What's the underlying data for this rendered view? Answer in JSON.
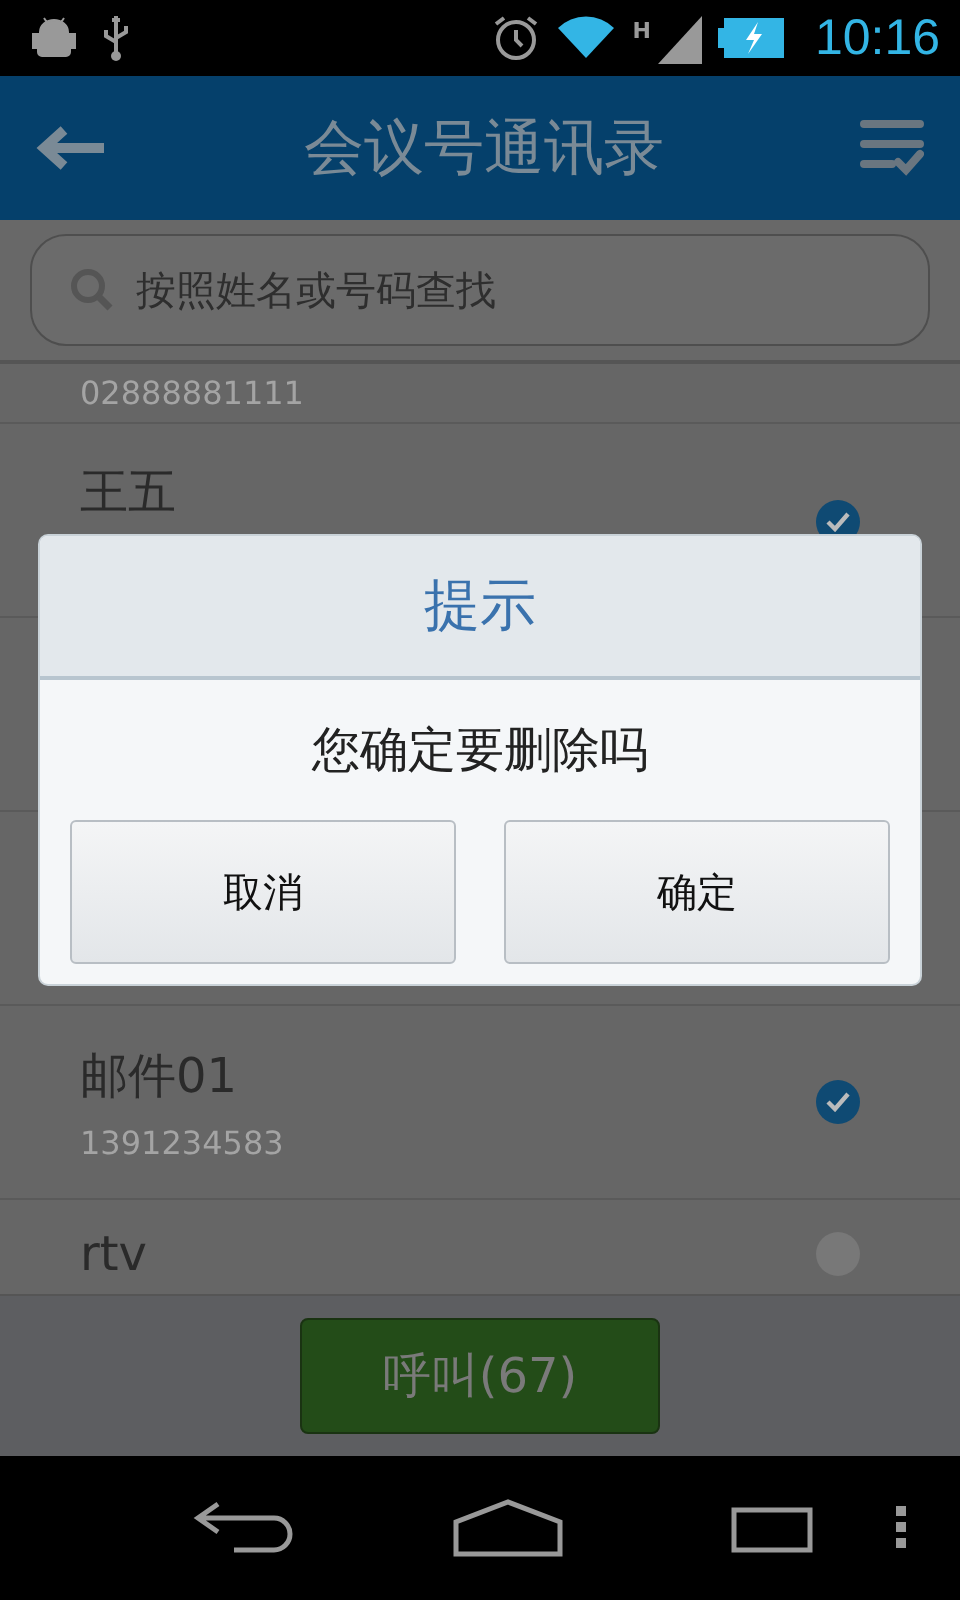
{
  "status_bar": {
    "network": "H",
    "time": "10:16"
  },
  "app_bar": {
    "title": "会议号通讯录"
  },
  "search": {
    "placeholder": "按照姓名或号码查找"
  },
  "contacts": [
    {
      "number": "02888881111"
    },
    {
      "name": "王五",
      "checked": true
    },
    {
      "name": "邮件01",
      "number": "1391234583",
      "checked": true
    },
    {
      "name": "rtv",
      "checked": false
    }
  ],
  "call_button": {
    "label": "呼叫(67)"
  },
  "dialog": {
    "title": "提示",
    "message": "您确定要删除吗",
    "buttons": [
      "取消",
      "确定"
    ]
  }
}
